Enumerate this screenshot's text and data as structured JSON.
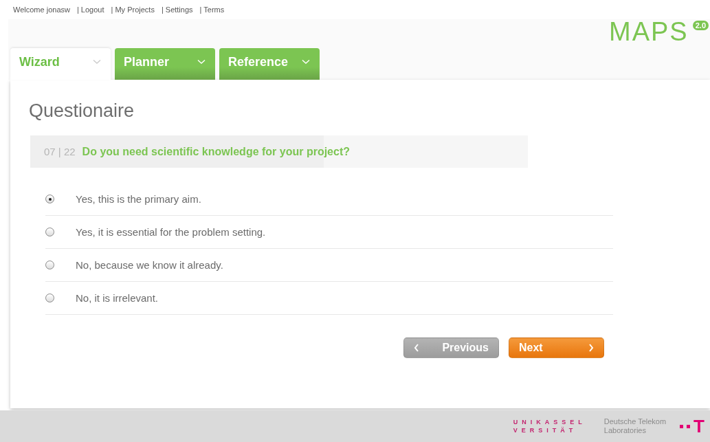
{
  "top_links": [
    "Welcome jonasw",
    "| Logout",
    "| My Projects",
    "| Settings",
    "| Terms"
  ],
  "logo": {
    "name": "MAPS",
    "version": "2.0"
  },
  "tabs": [
    {
      "label": "Wizard",
      "selected": true
    },
    {
      "label": "Planner",
      "selected": false
    },
    {
      "label": "Reference",
      "selected": false
    }
  ],
  "title": "Questionaire",
  "question": {
    "counter": "07 | 22",
    "text": "Do you need scientific knowledge for your project?"
  },
  "answers": [
    {
      "label": "Yes, this is the primary aim.",
      "selected": true
    },
    {
      "label": "Yes, it is essential for the problem setting.",
      "selected": false
    },
    {
      "label": "No, because we know it already.",
      "selected": false
    },
    {
      "label": "No, it is irrelevant.",
      "selected": false
    }
  ],
  "buttons": [
    {
      "label": "Previous",
      "kind": "previous",
      "disabled": true
    },
    {
      "label": "Next",
      "kind": "next",
      "disabled": false
    }
  ],
  "footer": {
    "university": [
      "UNIKASSEL",
      "VERSITÄT"
    ],
    "lab": [
      "Deutsche Telekom",
      "Laboratories"
    ],
    "lab_mark": "T"
  }
}
